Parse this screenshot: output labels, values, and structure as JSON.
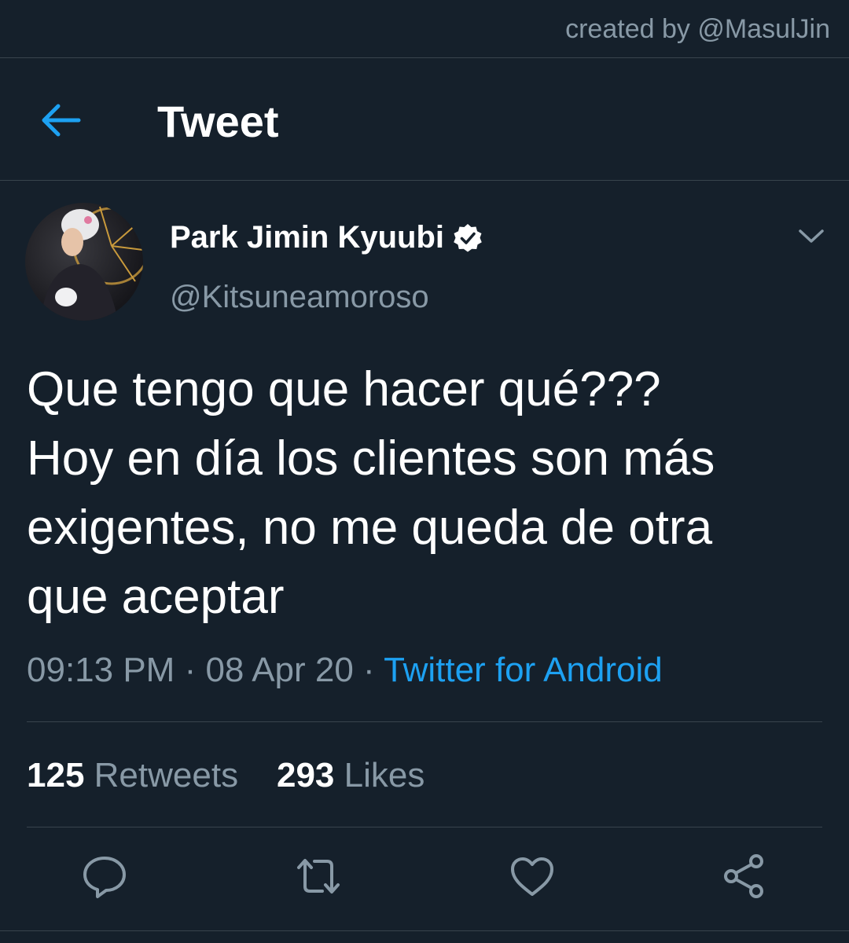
{
  "watermark": "created by @MasulJin",
  "header": {
    "title": "Tweet",
    "back_icon": "arrow-left-icon"
  },
  "author": {
    "display_name": "Park Jimin Kyuubi",
    "handle": "@Kitsuneamoroso",
    "verified": true,
    "verified_icon": "verified-badge-icon"
  },
  "tweet": {
    "lines": [
      "Que tengo que hacer qué???",
      "Hoy en día los clientes son más",
      "exigentes, no me queda de otra",
      "que aceptar"
    ]
  },
  "meta": {
    "time": "09:13 PM",
    "separator": " · ",
    "date": "08 Apr 20",
    "source": "Twitter for Android"
  },
  "stats": {
    "retweets_count": "125",
    "retweets_label": "Retweets",
    "likes_count": "293",
    "likes_label": "Likes"
  },
  "actions": [
    "reply-icon",
    "retweet-icon",
    "like-icon",
    "share-icon"
  ],
  "colors": {
    "background": "#15202b",
    "accent": "#1da1f2",
    "secondary_text": "#8899a6",
    "divider": "#38444d"
  }
}
